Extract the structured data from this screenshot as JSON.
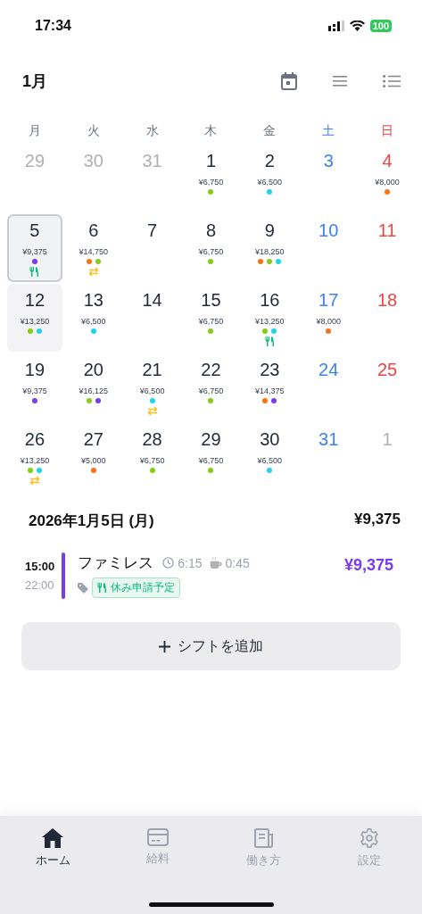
{
  "status_bar": {
    "time": "17:34",
    "battery": "100"
  },
  "header": {
    "month": "1月"
  },
  "weekdays": [
    {
      "label": "月",
      "kind": "weekday"
    },
    {
      "label": "火",
      "kind": "weekday"
    },
    {
      "label": "水",
      "kind": "weekday"
    },
    {
      "label": "木",
      "kind": "weekday"
    },
    {
      "label": "金",
      "kind": "weekday"
    },
    {
      "label": "土",
      "kind": "sat"
    },
    {
      "label": "日",
      "kind": "sun"
    }
  ],
  "days": [
    {
      "day": "29",
      "kind": "other",
      "selected": false,
      "today": false
    },
    {
      "day": "30",
      "kind": "other",
      "selected": false,
      "today": false
    },
    {
      "day": "31",
      "kind": "other",
      "selected": false,
      "today": false
    },
    {
      "day": "1",
      "kind": "weekday",
      "selected": false,
      "today": false,
      "amount": "¥6,750",
      "dots": [
        {
          "color": "#84cc16"
        }
      ]
    },
    {
      "day": "2",
      "kind": "weekday",
      "selected": false,
      "today": false,
      "amount": "¥6,500",
      "dots": [
        {
          "color": "#22d3ee"
        }
      ]
    },
    {
      "day": "3",
      "kind": "sat",
      "selected": false,
      "today": false
    },
    {
      "day": "4",
      "kind": "sun",
      "selected": false,
      "today": false,
      "amount": "¥8,000",
      "dots": [
        {
          "color": "#f97316"
        }
      ]
    },
    {
      "day": "5",
      "kind": "weekday",
      "selected": true,
      "today": false,
      "amount": "¥9,375",
      "dots": [
        {
          "color": "#7c3aed"
        }
      ],
      "marks": [
        {
          "kind": "meal"
        }
      ]
    },
    {
      "day": "6",
      "kind": "weekday",
      "selected": false,
      "today": false,
      "amount": "¥14,750",
      "dots": [
        {
          "color": "#f97316"
        },
        {
          "color": "#84cc16"
        }
      ],
      "marks": [
        {
          "kind": "swap"
        }
      ]
    },
    {
      "day": "7",
      "kind": "weekday",
      "selected": false,
      "today": false
    },
    {
      "day": "8",
      "kind": "weekday",
      "selected": false,
      "today": false,
      "amount": "¥6,750",
      "dots": [
        {
          "color": "#84cc16"
        }
      ]
    },
    {
      "day": "9",
      "kind": "weekday",
      "selected": false,
      "today": false,
      "amount": "¥18,250",
      "dots": [
        {
          "color": "#f97316"
        },
        {
          "color": "#84cc16"
        },
        {
          "color": "#22d3ee"
        }
      ]
    },
    {
      "day": "10",
      "kind": "sat",
      "selected": false,
      "today": false
    },
    {
      "day": "11",
      "kind": "sun",
      "selected": false,
      "today": false
    },
    {
      "day": "12",
      "kind": "weekday",
      "selected": false,
      "today": true,
      "amount": "¥13,250",
      "dots": [
        {
          "color": "#84cc16"
        },
        {
          "color": "#22d3ee"
        }
      ]
    },
    {
      "day": "13",
      "kind": "weekday",
      "selected": false,
      "today": false,
      "amount": "¥6,500",
      "dots": [
        {
          "color": "#22d3ee"
        }
      ]
    },
    {
      "day": "14",
      "kind": "weekday",
      "selected": false,
      "today": false
    },
    {
      "day": "15",
      "kind": "weekday",
      "selected": false,
      "today": false,
      "amount": "¥6,750",
      "dots": [
        {
          "color": "#84cc16"
        }
      ]
    },
    {
      "day": "16",
      "kind": "weekday",
      "selected": false,
      "today": false,
      "amount": "¥13,250",
      "dots": [
        {
          "color": "#84cc16"
        },
        {
          "color": "#22d3ee"
        }
      ],
      "marks": [
        {
          "kind": "meal"
        }
      ]
    },
    {
      "day": "17",
      "kind": "sat",
      "selected": false,
      "today": false,
      "amount": "¥8,000",
      "dots": [
        {
          "color": "#f97316"
        }
      ]
    },
    {
      "day": "18",
      "kind": "sun",
      "selected": false,
      "today": false
    },
    {
      "day": "19",
      "kind": "weekday",
      "selected": false,
      "today": false,
      "amount": "¥9,375",
      "dots": [
        {
          "color": "#7c3aed"
        }
      ]
    },
    {
      "day": "20",
      "kind": "weekday",
      "selected": false,
      "today": false,
      "amount": "¥16,125",
      "dots": [
        {
          "color": "#84cc16"
        },
        {
          "color": "#7c3aed"
        }
      ]
    },
    {
      "day": "21",
      "kind": "weekday",
      "selected": false,
      "today": false,
      "amount": "¥6,500",
      "dots": [
        {
          "color": "#22d3ee"
        }
      ],
      "marks": [
        {
          "kind": "swap"
        }
      ]
    },
    {
      "day": "22",
      "kind": "weekday",
      "selected": false,
      "today": false,
      "amount": "¥6,750",
      "dots": [
        {
          "color": "#84cc16"
        }
      ]
    },
    {
      "day": "23",
      "kind": "weekday",
      "selected": false,
      "today": false,
      "amount": "¥14,375",
      "dots": [
        {
          "color": "#f97316"
        },
        {
          "color": "#7c3aed"
        }
      ]
    },
    {
      "day": "24",
      "kind": "sat",
      "selected": false,
      "today": false
    },
    {
      "day": "25",
      "kind": "sun",
      "selected": false,
      "today": false
    },
    {
      "day": "26",
      "kind": "weekday",
      "selected": false,
      "today": false,
      "amount": "¥13,250",
      "dots": [
        {
          "color": "#84cc16"
        },
        {
          "color": "#22d3ee"
        }
      ],
      "marks": [
        {
          "kind": "swap"
        }
      ]
    },
    {
      "day": "27",
      "kind": "weekday",
      "selected": false,
      "today": false,
      "amount": "¥5,000",
      "dots": [
        {
          "color": "#f97316"
        }
      ]
    },
    {
      "day": "28",
      "kind": "weekday",
      "selected": false,
      "today": false,
      "amount": "¥6,750",
      "dots": [
        {
          "color": "#84cc16"
        }
      ]
    },
    {
      "day": "29",
      "kind": "weekday",
      "selected": false,
      "today": false,
      "amount": "¥6,750",
      "dots": [
        {
          "color": "#84cc16"
        }
      ]
    },
    {
      "day": "30",
      "kind": "weekday",
      "selected": false,
      "today": false,
      "amount": "¥6,500",
      "dots": [
        {
          "color": "#22d3ee"
        }
      ]
    },
    {
      "day": "31",
      "kind": "sat",
      "selected": false,
      "today": false
    },
    {
      "day": "1",
      "kind": "other",
      "selected": false,
      "today": false
    }
  ],
  "detail": {
    "date": "2026年1月5日 (月)",
    "total": "¥9,375",
    "shifts": [
      {
        "start": "15:00",
        "end": "22:00",
        "color": "#7c3aed",
        "name": "ファミレス",
        "duration": "6:15",
        "break": "0:45",
        "amount": "¥9,375",
        "tags": [
          {
            "kind": "meal",
            "label": "休み申請予定"
          }
        ]
      }
    ]
  },
  "add_button": "シフトを追加",
  "tabs": [
    {
      "label": "ホーム",
      "kind": "home",
      "selected": true
    },
    {
      "label": "給料",
      "kind": "card",
      "selected": false
    },
    {
      "label": "働き方",
      "kind": "doc",
      "selected": false
    },
    {
      "label": "設定",
      "kind": "gear",
      "selected": false
    }
  ]
}
